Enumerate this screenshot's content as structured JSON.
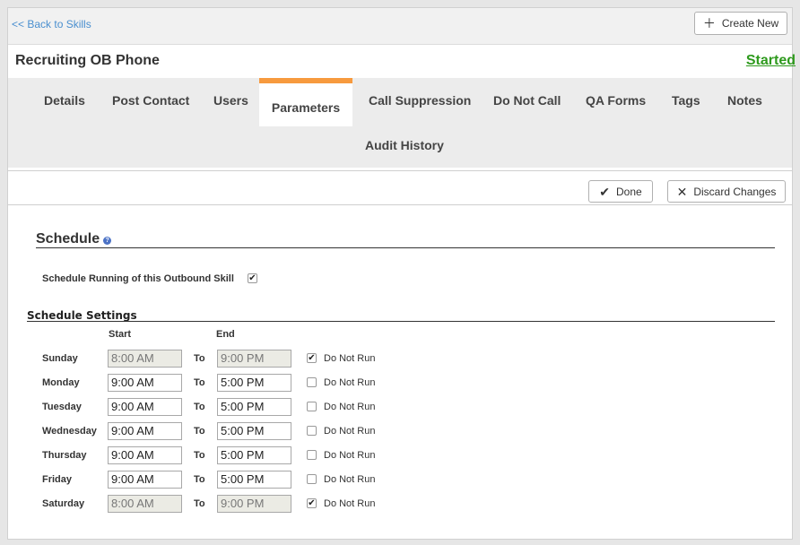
{
  "topbar": {
    "back_label": "<< Back to Skills",
    "create_label": "Create New",
    "create_icon": "plus-icon"
  },
  "header": {
    "title": "Recruiting OB Phone",
    "status": "Started"
  },
  "tabs": [
    {
      "label": "Details"
    },
    {
      "label": "Post Contact"
    },
    {
      "label": "Users"
    },
    {
      "label": "Parameters",
      "active": true
    },
    {
      "label": "Call Suppression"
    },
    {
      "label": "Do Not Call"
    },
    {
      "label": "QA Forms"
    },
    {
      "label": "Tags"
    },
    {
      "label": "Notes"
    },
    {
      "label": "Audit History"
    }
  ],
  "actions": {
    "done_label": "Done",
    "discard_label": "Discard Changes"
  },
  "schedule": {
    "title": "Schedule",
    "help_glyph": "?",
    "run_label": "Schedule Running of this Outbound Skill",
    "run_checked": true,
    "settings_title": "Schedule Settings",
    "start_header": "Start",
    "end_header": "End",
    "to_label": "To",
    "dnr_label": "Do Not Run",
    "days": [
      {
        "day": "Sunday",
        "start": "8:00 AM",
        "end": "9:00 PM",
        "do_not_run": true
      },
      {
        "day": "Monday",
        "start": "9:00 AM",
        "end": "5:00 PM",
        "do_not_run": false
      },
      {
        "day": "Tuesday",
        "start": "9:00 AM",
        "end": "5:00 PM",
        "do_not_run": false
      },
      {
        "day": "Wednesday",
        "start": "9:00 AM",
        "end": "5:00 PM",
        "do_not_run": false
      },
      {
        "day": "Thursday",
        "start": "9:00 AM",
        "end": "5:00 PM",
        "do_not_run": false
      },
      {
        "day": "Friday",
        "start": "9:00 AM",
        "end": "5:00 PM",
        "do_not_run": false
      },
      {
        "day": "Saturday",
        "start": "8:00 AM",
        "end": "9:00 PM",
        "do_not_run": true
      }
    ]
  },
  "colors": {
    "accent": "#f79a3e",
    "status": "#2e9a1d",
    "link": "#4a8fcf"
  }
}
